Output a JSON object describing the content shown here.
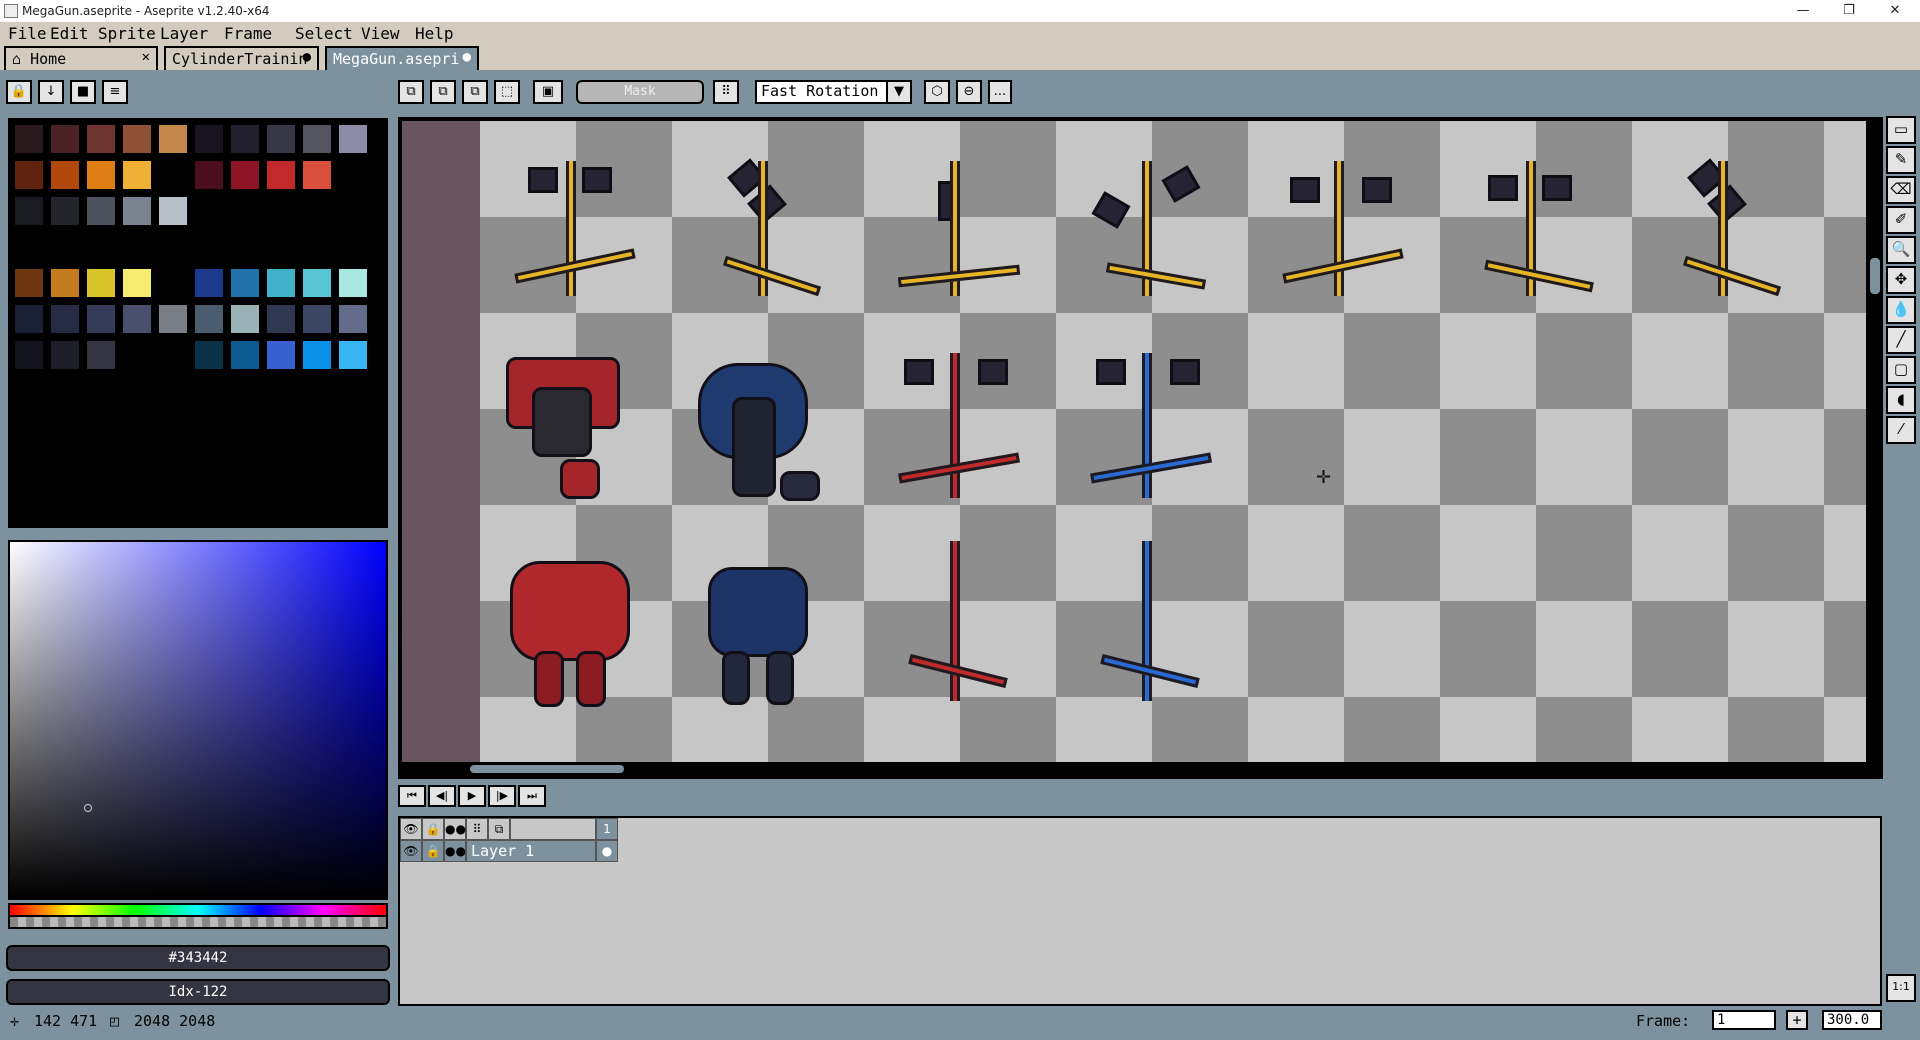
{
  "window": {
    "title": "MegaGun.aseprite - Aseprite v1.2.40-x64",
    "minimize_glyph": "—",
    "maximize_glyph": "❐",
    "close_glyph": "✕"
  },
  "menu": [
    "File",
    "Edit",
    "Sprite",
    "Layer",
    "Frame",
    "Select",
    "View",
    "Help"
  ],
  "tabs": [
    {
      "label": "Home",
      "close": "✕",
      "icon": "home-icon"
    },
    {
      "label": "CylinderTrainin",
      "close": "●"
    },
    {
      "label": "MegaGun.asepri",
      "close": "●"
    }
  ],
  "palette_toolbar": [
    "🔒",
    "↓",
    "■",
    "≡"
  ],
  "context_bar": {
    "mask_label": "Mask",
    "rotation_algorithm": "Fast Rotation",
    "more_label": "..."
  },
  "palette": {
    "rows": [
      [
        "#2a1a1e",
        "#4a2226",
        "#6e3432",
        "#8e5036",
        "#c3874b",
        "#1a1420",
        "#23202e",
        "#363644",
        "#555562",
        "#8c8ca6"
      ],
      [
        "#62230e",
        "#b3480c",
        "#df7e14",
        "#efae34",
        "#000000",
        "#4a0e1e",
        "#8c1424",
        "#c1292a",
        "#d8503b",
        "#000000"
      ],
      [
        "#1a1a22",
        "#24242c",
        "#4e525e",
        "#7b8290",
        "#b7bfc8",
        "#000000",
        "#000000",
        "#000000",
        "#000000",
        "#000000"
      ],
      [
        "#000000",
        "#000000",
        "#000000",
        "#000000",
        "#000000",
        "#000000",
        "#000000",
        "#000000",
        "#000000",
        "#000000"
      ],
      [
        "#6e3610",
        "#c47a1e",
        "#d8c628",
        "#f8ec70",
        "#000000",
        "#1c3a8c",
        "#1f72aa",
        "#3fb1c8",
        "#58c6d4",
        "#a8e8e0"
      ],
      [
        "#1a2036",
        "#262c46",
        "#343c5a",
        "#48506e",
        "#7a7e86",
        "#4a5c6e",
        "#9ab2b6",
        "#2e3850",
        "#3a4664",
        "#626c8a"
      ],
      [
        "#14141e",
        "#1e1e2a",
        "#343442",
        "#000000",
        "#000000",
        "#073247",
        "#0a5a90",
        "#3860d0",
        "#0a90e8",
        "#38b6f4"
      ]
    ]
  },
  "color": {
    "hex": "#343442",
    "index": "Idx-122"
  },
  "status": {
    "cursor_pos": "142 471",
    "sprite_size": "2048 2048",
    "frame_label": "Frame:",
    "frame_value": "1",
    "add_frame": "+",
    "zoom": "300.0"
  },
  "timeline": {
    "frame_number": "1",
    "layer_name": "Layer 1"
  },
  "right_tools": [
    "▭",
    "✎",
    "⌫",
    "✐",
    "🔍",
    "✥",
    "💧",
    "╱",
    "▢",
    "◖",
    "⁄"
  ],
  "ratio_label": "1:1",
  "playback": [
    "⏮",
    "◀|",
    "▶",
    "|▶",
    "⏭"
  ]
}
